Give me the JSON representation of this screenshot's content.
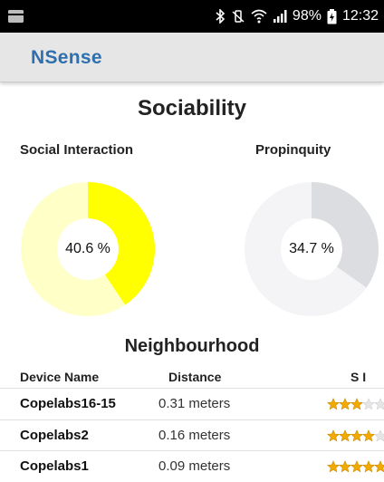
{
  "status_bar": {
    "battery": "98%",
    "time": "12:32",
    "icons": [
      "notification-icon",
      "bluetooth-icon",
      "vibrate-icon",
      "wifi-icon",
      "signal-icon",
      "battery-icon"
    ]
  },
  "app_bar": {
    "title": "NSense"
  },
  "page": {
    "title": "Sociability"
  },
  "charts": {
    "social": {
      "label": "Social Interaction",
      "value_text": "40.6 %"
    },
    "propinquity": {
      "label": "Propinquity",
      "value_text": "34.7 %"
    }
  },
  "colors": {
    "app_title": "#2f6fae",
    "social_fill": "#ffff00",
    "social_track": "#ffffc8",
    "propinquity_fill": "#dcdde0",
    "propinquity_track": "#f4f4f6",
    "star": "#f2a900",
    "star_empty": "#e6e6e6"
  },
  "chart_data": [
    {
      "type": "pie",
      "title": "Social Interaction",
      "values": [
        40.6,
        59.4
      ],
      "center_label": "40.6 %"
    },
    {
      "type": "pie",
      "title": "Propinquity",
      "values": [
        34.7,
        65.3
      ],
      "center_label": "34.7 %"
    }
  ],
  "neighbourhood": {
    "title": "Neighbourhood",
    "columns": [
      "Device Name",
      "Distance",
      "S I"
    ],
    "rows": [
      {
        "name": "Copelabs16-15",
        "distance": "0.31 meters",
        "stars": 3
      },
      {
        "name": "Copelabs2",
        "distance": "0.16 meters",
        "stars": 4
      },
      {
        "name": "Copelabs1",
        "distance": "0.09 meters",
        "stars": 5
      }
    ]
  }
}
